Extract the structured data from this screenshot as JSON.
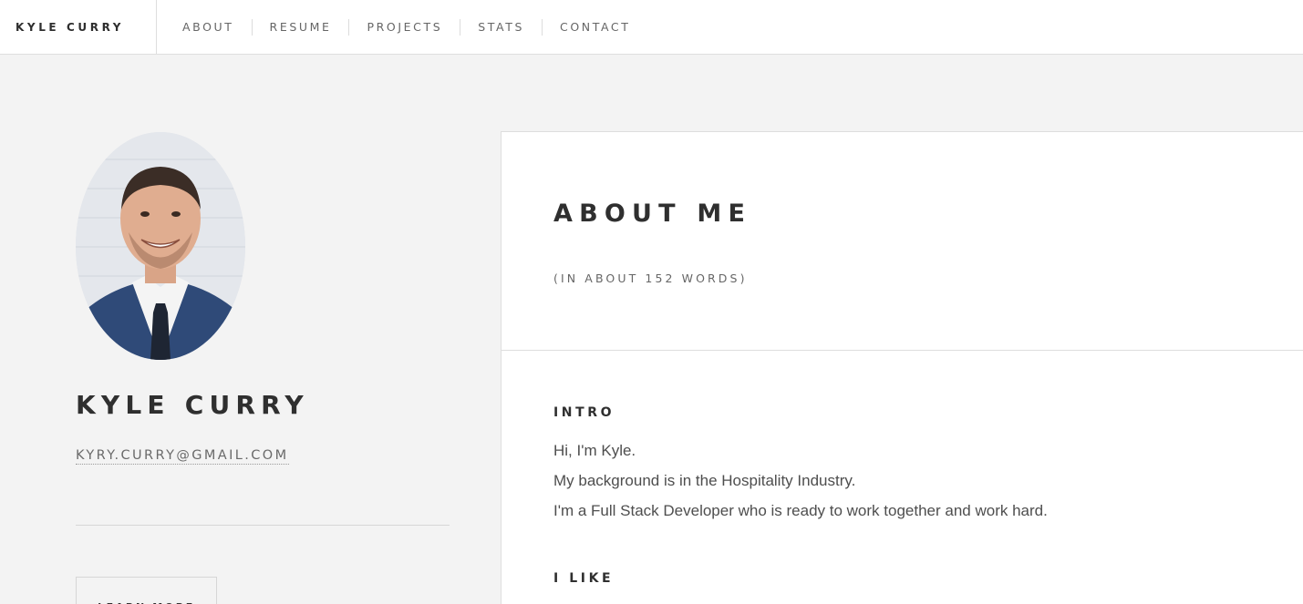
{
  "header": {
    "brand": "KYLE CURRY",
    "nav": [
      {
        "label": "ABOUT"
      },
      {
        "label": "RESUME"
      },
      {
        "label": "PROJECTS"
      },
      {
        "label": "STATS"
      },
      {
        "label": "CONTACT"
      }
    ]
  },
  "sidebar": {
    "avatar_icon": "profile-photo",
    "name": "KYLE CURRY",
    "email": "KYRY.CURRY@GMAIL.COM",
    "learn_more_label": "LEARN MORE"
  },
  "main": {
    "title": "ABOUT ME",
    "subtitle": "(IN ABOUT 152 WORDS)",
    "intro": {
      "heading": "INTRO",
      "lines": [
        "Hi, I'm Kyle.",
        "My background is in the Hospitality Industry.",
        "I'm a Full Stack Developer who is ready to work together and work hard."
      ]
    },
    "like": {
      "heading": "I LIKE"
    }
  },
  "colors": {
    "page_bg": "#f3f3f3",
    "card_bg": "#ffffff",
    "text_dark": "#2f2f2f",
    "text_muted": "#666666",
    "border": "#dedede"
  }
}
